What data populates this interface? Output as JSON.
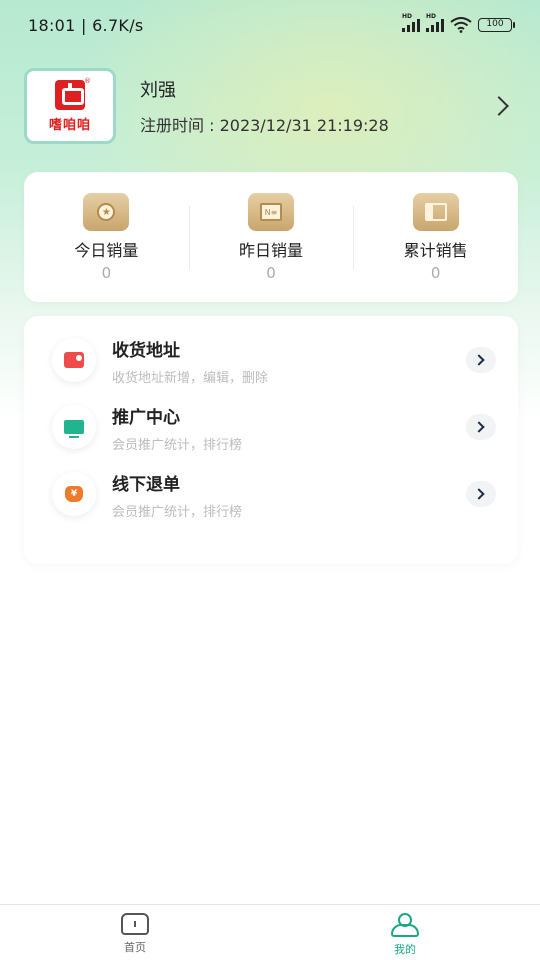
{
  "status_bar": {
    "time": "18:01",
    "speed": "6.7K/s",
    "battery": "100"
  },
  "profile": {
    "logo_text": "嗜咱咱",
    "name": "刘强",
    "register_label": "注册时间",
    "register_time": "2023/12/31 21:19:28"
  },
  "stats": [
    {
      "label": "今日销量",
      "value": "0",
      "icon": "medal-icon"
    },
    {
      "label": "昨日销量",
      "value": "0",
      "icon": "newspaper-icon"
    },
    {
      "label": "累计销售",
      "value": "0",
      "icon": "book-icon"
    }
  ],
  "menu": [
    {
      "title": "收货地址",
      "subtitle": "收货地址新增，编辑，删除",
      "icon": "address-icon",
      "color": "#ef4b4b"
    },
    {
      "title": "推广中心",
      "subtitle": "会员推广统计，排行榜",
      "icon": "promotion-icon",
      "color": "#22b48f"
    },
    {
      "title": "线下退单",
      "subtitle": "会员推广统计，排行榜",
      "icon": "refund-icon",
      "color": "#f07a2c"
    }
  ],
  "tabbar": {
    "home": "首页",
    "me": "我的",
    "active_color": "#1aa884"
  }
}
